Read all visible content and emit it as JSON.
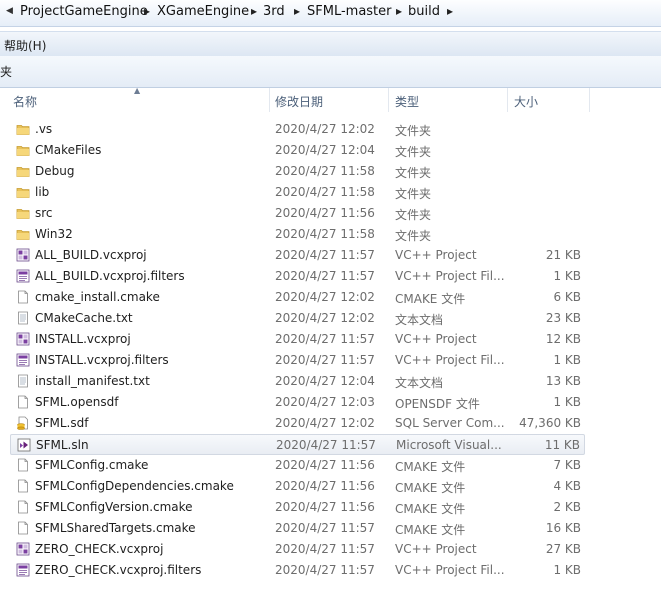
{
  "address": {
    "crumbs": [
      "ProjectGameEngine",
      "XGameEngine",
      "3rd",
      "SFML-master",
      "build"
    ]
  },
  "menu": {
    "help": "帮助(H)"
  },
  "command_bar": {
    "label": "夹"
  },
  "columns": {
    "name": "名称",
    "date": "修改日期",
    "type": "类型",
    "size": "大小"
  },
  "files": [
    {
      "name": ".vs",
      "date": "2020/4/27 12:02",
      "type": "文件夹",
      "size": "",
      "icon": "folder-icon"
    },
    {
      "name": "CMakeFiles",
      "date": "2020/4/27 12:04",
      "type": "文件夹",
      "size": "",
      "icon": "folder-icon"
    },
    {
      "name": "Debug",
      "date": "2020/4/27 11:58",
      "type": "文件夹",
      "size": "",
      "icon": "folder-icon"
    },
    {
      "name": "lib",
      "date": "2020/4/27 11:58",
      "type": "文件夹",
      "size": "",
      "icon": "folder-icon"
    },
    {
      "name": "src",
      "date": "2020/4/27 11:56",
      "type": "文件夹",
      "size": "",
      "icon": "folder-icon"
    },
    {
      "name": "Win32",
      "date": "2020/4/27 11:58",
      "type": "文件夹",
      "size": "",
      "icon": "folder-icon"
    },
    {
      "name": "ALL_BUILD.vcxproj",
      "date": "2020/4/27 11:57",
      "type": "VC++ Project",
      "size": "21 KB",
      "icon": "vcxproj-icon"
    },
    {
      "name": "ALL_BUILD.vcxproj.filters",
      "date": "2020/4/27 11:57",
      "type": "VC++ Project Fil...",
      "size": "1 KB",
      "icon": "vcxproj-filters-icon"
    },
    {
      "name": "cmake_install.cmake",
      "date": "2020/4/27 12:02",
      "type": "CMAKE 文件",
      "size": "6 KB",
      "icon": "file-icon"
    },
    {
      "name": "CMakeCache.txt",
      "date": "2020/4/27 12:02",
      "type": "文本文档",
      "size": "23 KB",
      "icon": "text-file-icon"
    },
    {
      "name": "INSTALL.vcxproj",
      "date": "2020/4/27 11:57",
      "type": "VC++ Project",
      "size": "12 KB",
      "icon": "vcxproj-icon"
    },
    {
      "name": "INSTALL.vcxproj.filters",
      "date": "2020/4/27 11:57",
      "type": "VC++ Project Fil...",
      "size": "1 KB",
      "icon": "vcxproj-filters-icon"
    },
    {
      "name": "install_manifest.txt",
      "date": "2020/4/27 12:04",
      "type": "文本文档",
      "size": "13 KB",
      "icon": "text-file-icon"
    },
    {
      "name": "SFML.opensdf",
      "date": "2020/4/27 12:03",
      "type": "OPENSDF 文件",
      "size": "1 KB",
      "icon": "file-icon"
    },
    {
      "name": "SFML.sdf",
      "date": "2020/4/27 12:02",
      "type": "SQL Server Com...",
      "size": "47,360 KB",
      "icon": "sdf-icon"
    },
    {
      "name": "SFML.sln",
      "date": "2020/4/27 11:57",
      "type": "Microsoft Visual...",
      "size": "11 KB",
      "icon": "sln-icon",
      "selected": true
    },
    {
      "name": "SFMLConfig.cmake",
      "date": "2020/4/27 11:56",
      "type": "CMAKE 文件",
      "size": "7 KB",
      "icon": "file-icon"
    },
    {
      "name": "SFMLConfigDependencies.cmake",
      "date": "2020/4/27 11:56",
      "type": "CMAKE 文件",
      "size": "4 KB",
      "icon": "file-icon"
    },
    {
      "name": "SFMLConfigVersion.cmake",
      "date": "2020/4/27 11:56",
      "type": "CMAKE 文件",
      "size": "2 KB",
      "icon": "file-icon"
    },
    {
      "name": "SFMLSharedTargets.cmake",
      "date": "2020/4/27 11:57",
      "type": "CMAKE 文件",
      "size": "16 KB",
      "icon": "file-icon"
    },
    {
      "name": "ZERO_CHECK.vcxproj",
      "date": "2020/4/27 11:57",
      "type": "VC++ Project",
      "size": "27 KB",
      "icon": "vcxproj-icon"
    },
    {
      "name": "ZERO_CHECK.vcxproj.filters",
      "date": "2020/4/27 11:57",
      "type": "VC++ Project Fil...",
      "size": "1 KB",
      "icon": "vcxproj-filters-icon"
    }
  ]
}
